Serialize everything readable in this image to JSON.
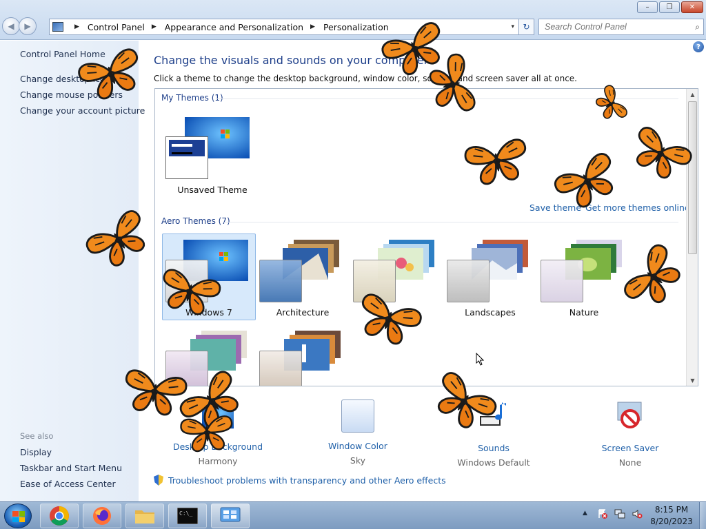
{
  "window": {
    "controls": {
      "minimize": "–",
      "maximize": "❐",
      "close": "✕"
    }
  },
  "nav": {
    "back": "◀",
    "forward": "▶"
  },
  "address": {
    "crumbs": [
      "Control Panel",
      "Appearance and Personalization",
      "Personalization"
    ],
    "dropdown": "▾",
    "refresh": "↻"
  },
  "search": {
    "placeholder": "Search Control Panel",
    "icon": "🔍"
  },
  "sidebar": {
    "home": "Control Panel Home",
    "links": [
      "Change desktop icons",
      "Change mouse pointers",
      "Change your account picture"
    ],
    "see_also_title": "See also",
    "see_also": [
      "Display",
      "Taskbar and Start Menu",
      "Ease of Access Center"
    ]
  },
  "main": {
    "help": "?",
    "heading": "Change the visuals and sounds on your computer",
    "subheading": "Click a theme to change the desktop background, window color, sounds, and screen saver all at once.",
    "my_themes_header": "My Themes (1)",
    "aero_themes_header": "Aero Themes (7)",
    "save_theme": "Save theme",
    "get_more": "Get more themes online",
    "my_themes": [
      {
        "label": "Unsaved Theme"
      }
    ],
    "aero_themes": [
      {
        "label": "Windows 7",
        "selected": true
      },
      {
        "label": "Architecture"
      },
      {
        "label": ""
      },
      {
        "label": "Landscapes"
      },
      {
        "label": "Nature"
      },
      {
        "label": ""
      },
      {
        "label": ""
      }
    ]
  },
  "bottom": [
    {
      "label": "Desktop Background",
      "value": "Harmony",
      "icon": "desktop-background-icon"
    },
    {
      "label": "Window Color",
      "value": "Sky",
      "icon": "window-color-icon"
    },
    {
      "label": "Sounds",
      "value": "Windows Default",
      "icon": "sounds-icon"
    },
    {
      "label": "Screen Saver",
      "value": "None",
      "icon": "screen-saver-icon"
    }
  ],
  "troubleshoot": "Troubleshoot problems with transparency and other Aero effects",
  "taskbar": {
    "apps": [
      "chrome",
      "firefox",
      "file-explorer",
      "command-prompt",
      "control-panel"
    ],
    "time": "8:15 PM",
    "date": "8/20/2023"
  },
  "colors": {
    "link": "#1e5fa8",
    "heading": "#1e3f8a",
    "accent": "#ff8c1a"
  }
}
